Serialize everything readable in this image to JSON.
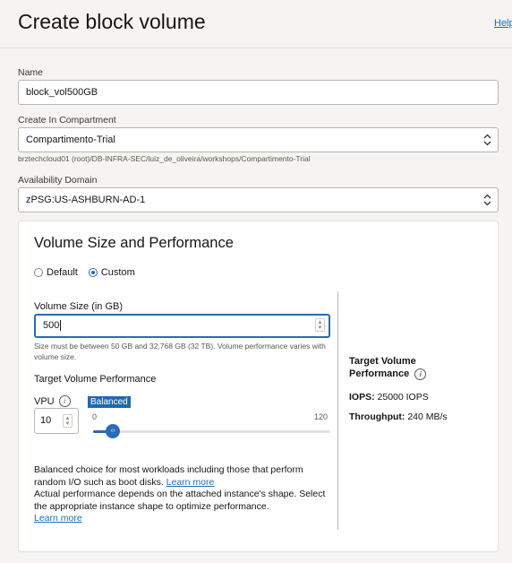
{
  "header": {
    "title": "Create block volume",
    "help": "Help"
  },
  "name": {
    "label": "Name",
    "value": "block_vol500GB"
  },
  "compartment": {
    "label": "Create In Compartment",
    "value": "Compartimento-Trial",
    "path": "brztechcloud01 (root)/DB-INFRA-SEC/luiz_de_oliveira/workshops/Compartimento-Trial"
  },
  "availability_domain": {
    "label": "Availability Domain",
    "value": "zPSG:US-ASHBURN-AD-1"
  },
  "performance": {
    "title": "Volume Size and Performance",
    "options": {
      "default": "Default",
      "custom": "Custom",
      "selected": "Custom"
    },
    "size_label": "Volume Size (in GB)",
    "size_value": "500",
    "size_hint": "Size must be between 50 GB and 32,768 GB (32 TB). Volume performance varies with volume size.",
    "target_label": "Target Volume Performance",
    "vpu_label": "VPU",
    "vpu_value": "10",
    "slider": {
      "badge": "Balanced",
      "min": "0",
      "max": "120",
      "value": 10
    },
    "desc_1": "Balanced choice for most workloads including those that perform random I/O such as boot disks.",
    "learn_more_1": "Learn more",
    "desc_2": "Actual performance depends on the attached instance's shape. Select the appropriate instance shape to optimize performance.",
    "learn_more_2": "Learn more",
    "right_title": "Target Volume Performance",
    "iops_label": "IOPS:",
    "iops_value": "25000 IOPS",
    "throughput_label": "Throughput:",
    "throughput_value": "240 MB/s"
  },
  "colors": {
    "accent": "#2a6bb5",
    "badge": "#1e6ab0",
    "link": "#1a6fb5"
  }
}
